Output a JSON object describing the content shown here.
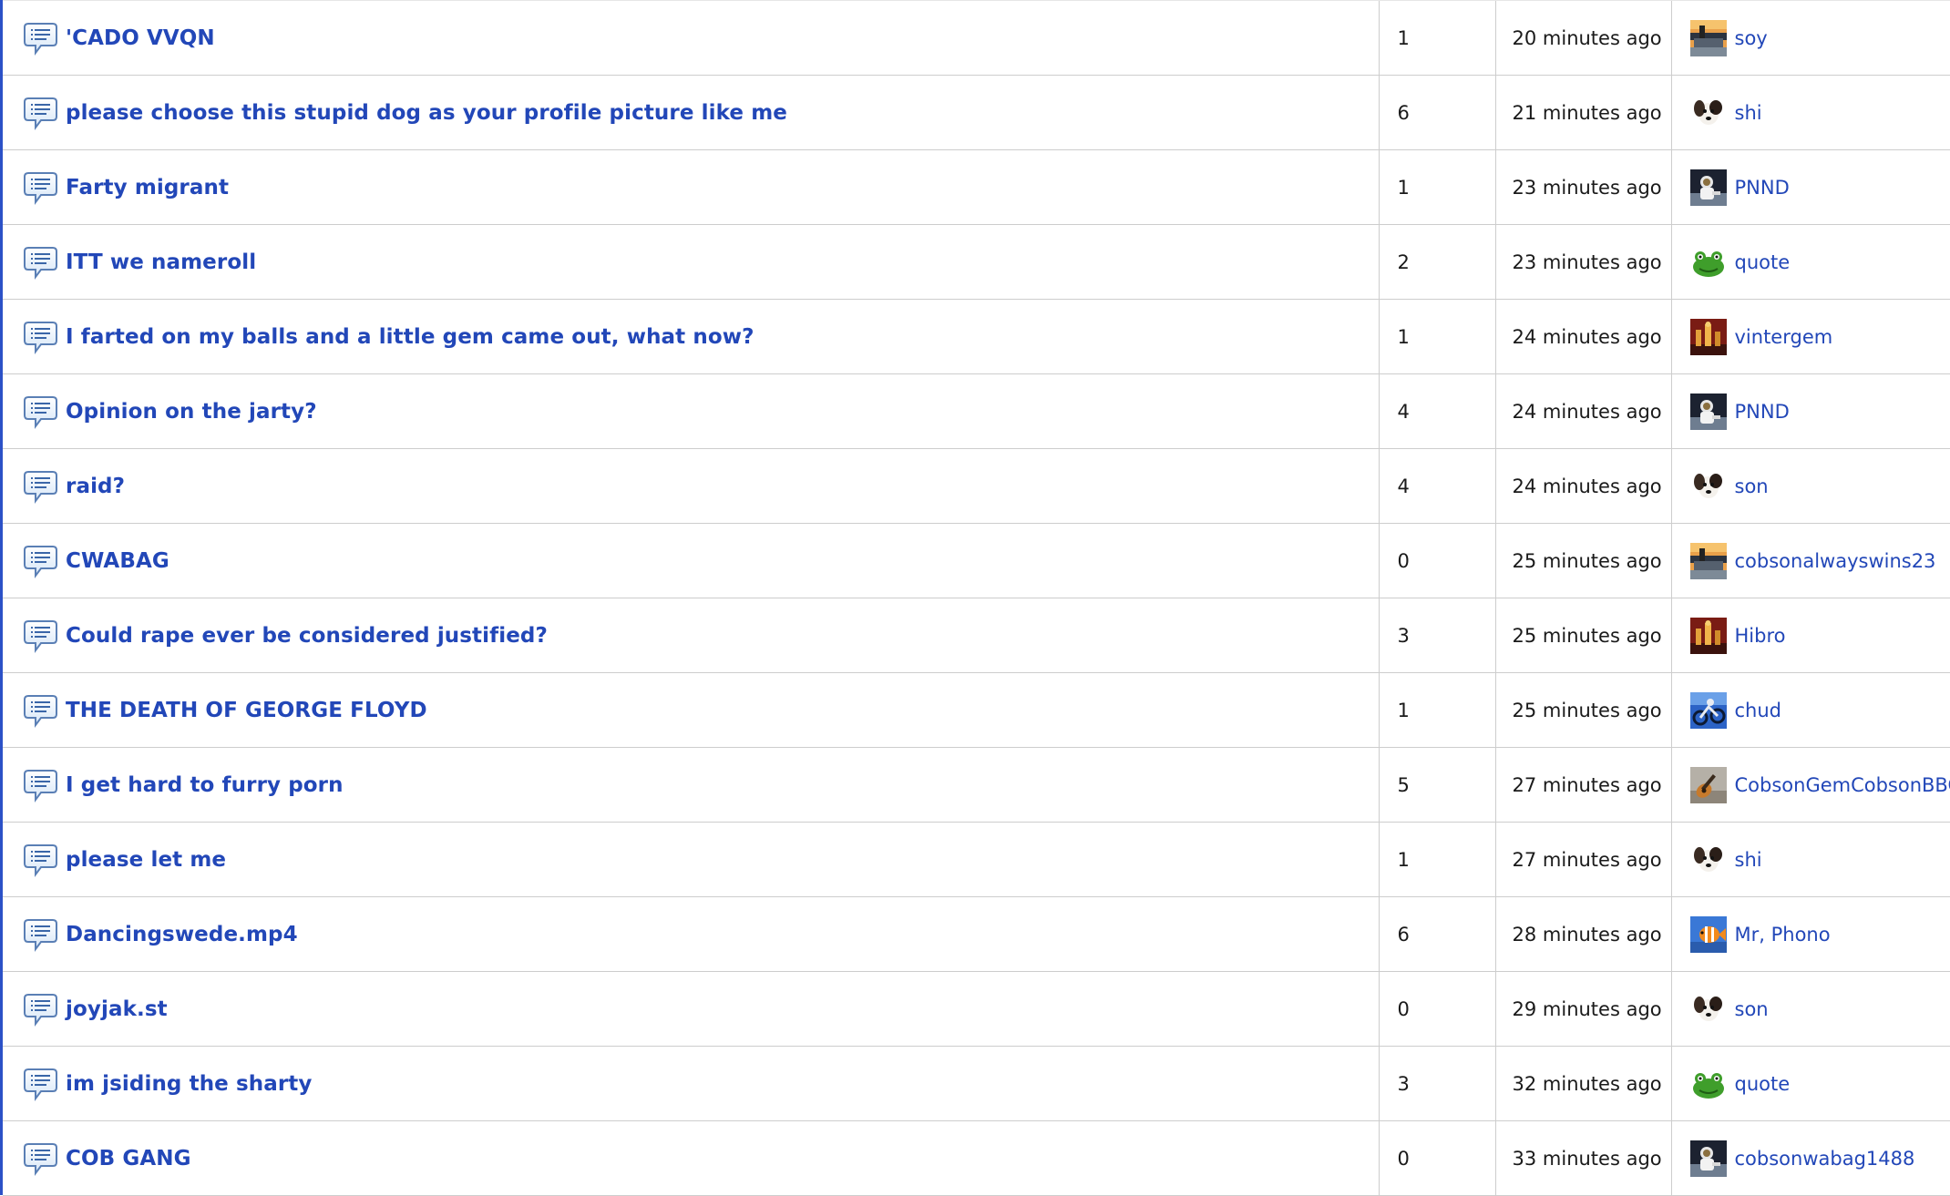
{
  "threads": [
    {
      "title": "'CADO VVQN",
      "replies": "1",
      "time": "20 minutes ago",
      "author": "soy",
      "avatar": "ship-avatar"
    },
    {
      "title": "please choose this stupid dog as your profile picture like me",
      "replies": "6",
      "time": "21 minutes ago",
      "author": "shi",
      "avatar": "dog-avatar"
    },
    {
      "title": "Farty migrant",
      "replies": "1",
      "time": "23 minutes ago",
      "author": "PNND",
      "avatar": "astronaut-avatar"
    },
    {
      "title": "ITT we nameroll",
      "replies": "2",
      "time": "23 minutes ago",
      "author": "quote",
      "avatar": "frog-avatar"
    },
    {
      "title": "I farted on my balls and a little gem came out, what now?",
      "replies": "1",
      "time": "24 minutes ago",
      "author": "vintergem",
      "avatar": "chess-avatar"
    },
    {
      "title": "Opinion on the jarty?",
      "replies": "4",
      "time": "24 minutes ago",
      "author": "PNND",
      "avatar": "astronaut-avatar"
    },
    {
      "title": "raid?",
      "replies": "4",
      "time": "24 minutes ago",
      "author": "son",
      "avatar": "dog-avatar"
    },
    {
      "title": "CWABAG",
      "replies": "0",
      "time": "25 minutes ago",
      "author": "cobsonalwayswins23",
      "avatar": "ship-avatar"
    },
    {
      "title": "Could rape ever be considered justified?",
      "replies": "3",
      "time": "25 minutes ago",
      "author": "Hibro",
      "avatar": "chess-avatar"
    },
    {
      "title": "THE DEATH OF GEORGE FLOYD",
      "replies": "1",
      "time": "25 minutes ago",
      "author": "chud",
      "avatar": "bike-avatar"
    },
    {
      "title": "I get hard to furry porn",
      "replies": "5",
      "time": "27 minutes ago",
      "author": "CobsonGemCobsonBBC",
      "avatar": "guitar-avatar"
    },
    {
      "title": "please let me",
      "replies": "1",
      "time": "27 minutes ago",
      "author": "shi",
      "avatar": "dog-avatar"
    },
    {
      "title": "Dancingswede.mp4",
      "replies": "6",
      "time": "28 minutes ago",
      "author": "Mr, Phono",
      "avatar": "fish-avatar"
    },
    {
      "title": "joyjak.st",
      "replies": "0",
      "time": "29 minutes ago",
      "author": "son",
      "avatar": "dog-avatar"
    },
    {
      "title": "im jsiding the sharty",
      "replies": "3",
      "time": "32 minutes ago",
      "author": "quote",
      "avatar": "frog-avatar"
    },
    {
      "title": "COB GANG",
      "replies": "0",
      "time": "33 minutes ago",
      "author": "cobsonwabag1488",
      "avatar": "astronaut-avatar"
    }
  ]
}
